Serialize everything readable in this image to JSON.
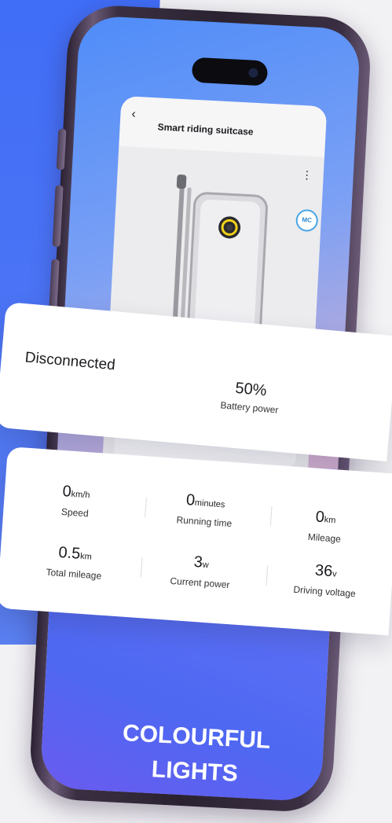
{
  "app": {
    "title": "Smart riding suitcase",
    "back_label": "‹",
    "menu_label": "⋮",
    "badge_text": "MC"
  },
  "status": {
    "connection": "Disconnected",
    "battery_value": "50%",
    "battery_label": "Battery power"
  },
  "stats": [
    {
      "value": "0",
      "unit": "km/h",
      "label": "Speed"
    },
    {
      "value": "0",
      "unit": "minutes",
      "label": "Running time"
    },
    {
      "value": "0",
      "unit": "km",
      "label": "Mileage"
    },
    {
      "value": "0.5",
      "unit": "km",
      "label": "Total mileage"
    },
    {
      "value": "3",
      "unit": "w",
      "label": "Current power"
    },
    {
      "value": "36",
      "unit": "v",
      "label": "Driving voltage"
    }
  ],
  "promo": {
    "line1": "COLOURFUL",
    "line2": "LIGHTS"
  },
  "colors": {
    "accent_blue": "#3f6df7",
    "screen_pink": "#f2b9c6",
    "frame_purple": "#6b5a77"
  },
  "icons": {
    "back": "chevron-left-icon",
    "menu": "more-vertical-icon",
    "badge": "mc-logo-icon"
  }
}
